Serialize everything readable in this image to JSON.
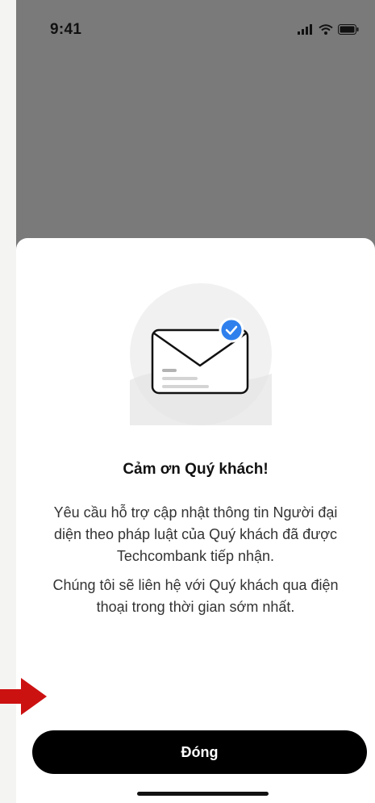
{
  "status_bar": {
    "time": "9:41"
  },
  "dialog": {
    "title": "Cảm ơn Quý khách!",
    "message_1": "Yêu cầu hỗ trợ cập nhật thông tin Người đại diện theo pháp luật của Quý khách đã được Techcombank tiếp nhận.",
    "message_2": "Chúng tôi sẽ liên hệ với Quý khách qua điện thoại trong thời gian sớm nhất.",
    "close_label": "Đóng"
  },
  "colors": {
    "overlay": "#7a7a7a",
    "check_badge": "#2f80ed",
    "button": "#000000",
    "annotation_arrow": "#cc1111"
  },
  "icons": {
    "illustration": "envelope-with-check-icon",
    "signal": "cellular-signal-icon",
    "wifi": "wifi-icon",
    "battery": "battery-icon",
    "annotation": "arrow-right-icon"
  }
}
